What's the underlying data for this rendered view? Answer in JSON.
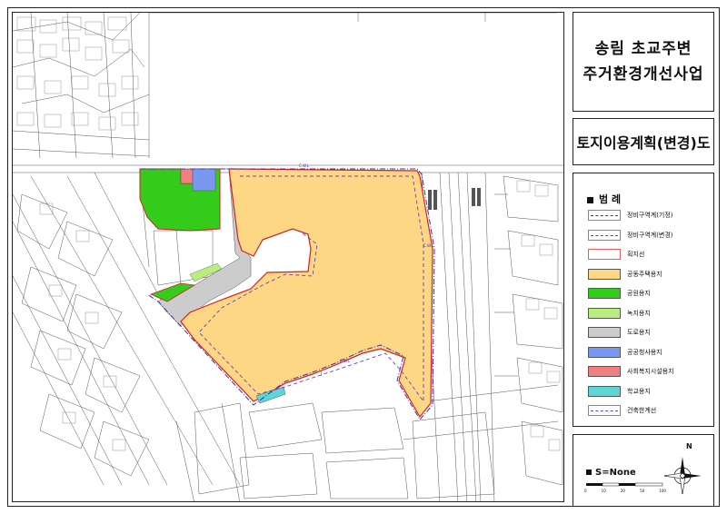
{
  "title": {
    "line1": "송림 초교주변",
    "line2": "주거환경개선사업"
  },
  "subtitle": "토지이용계획(변경)도",
  "legend": {
    "header": "범 례",
    "items": [
      {
        "label": "정비구역계(기정)",
        "style": "dash-blue",
        "color": "#3a2fb5"
      },
      {
        "label": "정비구역계(변경)",
        "style": "dash-red",
        "color": "#d42020"
      },
      {
        "label": "획지선",
        "style": "outline",
        "color": "#e06060"
      },
      {
        "label": "공동주택용지",
        "style": "fill",
        "color": "#fdd784"
      },
      {
        "label": "공원용지",
        "style": "fill",
        "color": "#33cc1a"
      },
      {
        "label": "녹지용지",
        "style": "fill",
        "color": "#b9ee7f"
      },
      {
        "label": "도로용지",
        "style": "fill",
        "color": "#cccccc"
      },
      {
        "label": "공공청사용지",
        "style": "fill",
        "color": "#7b98f0"
      },
      {
        "label": "사회복지시설용지",
        "style": "fill",
        "color": "#f28080"
      },
      {
        "label": "학교용지",
        "style": "fill",
        "color": "#5fd6d6"
      },
      {
        "label": "건축한계선",
        "style": "dash-purple",
        "color": "#6a3fc4"
      }
    ]
  },
  "scale": {
    "label": "S=None",
    "ticks": [
      "0",
      "10",
      "20",
      "50",
      "100"
    ]
  },
  "north_label": "N",
  "map_labels": {
    "top_boundary": "C.W.L",
    "right_boundary": "C.W.L",
    "bottom_boundary": "C.W.L"
  },
  "colors": {
    "apartment": "#fdd784",
    "park": "#33cc1a",
    "green": "#b9ee7f",
    "road": "#cccccc",
    "public": "#7b98f0",
    "welfare": "#f28080",
    "school": "#5fd6d6",
    "boundary_red": "#d42020",
    "boundary_blue": "#3a2fb5"
  }
}
